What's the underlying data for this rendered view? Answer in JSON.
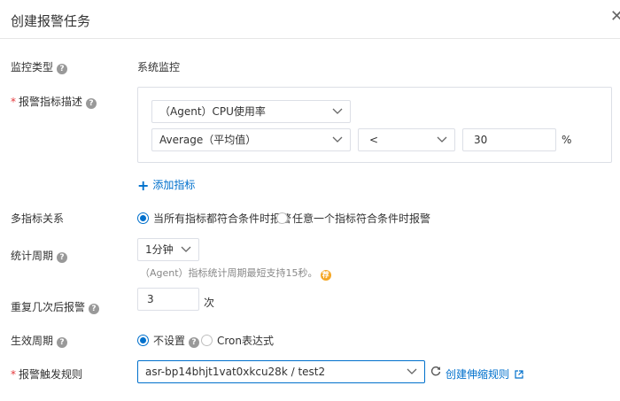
{
  "dialog": {
    "title": "创建报警任务",
    "close": "✕"
  },
  "monitor_type": {
    "label": "监控类型",
    "value": "系统监控"
  },
  "metric_desc": {
    "label": "报警指标描述",
    "metric": "（Agent）CPU使用率",
    "stat": "Average（平均值）",
    "operator": "<",
    "threshold": "30",
    "unit": "%"
  },
  "add_metric": {
    "label": "添加指标"
  },
  "multi_relation": {
    "label": "多指标关系",
    "options": [
      "当所有指标都符合条件时报警",
      "任意一个指标符合条件时报警"
    ],
    "selected": 0
  },
  "period": {
    "label": "统计周期",
    "value": "1分钟",
    "hint": "（Agent）指标统计周期最短支持15秒。",
    "hint_badge": "荐"
  },
  "repeat": {
    "label": "重复几次后报警",
    "value": "3",
    "unit": "次"
  },
  "effective": {
    "label": "生效周期",
    "options": [
      "不设置",
      "Cron表达式"
    ],
    "selected": 0
  },
  "trigger": {
    "label": "报警触发规则",
    "value": "asr-bp14bhjt1vat0xkcu28k / test2",
    "create_link": "创建伸缩规则"
  },
  "icons": {
    "help": "help-icon",
    "refresh": "refresh-icon",
    "external": "external-link-icon"
  }
}
